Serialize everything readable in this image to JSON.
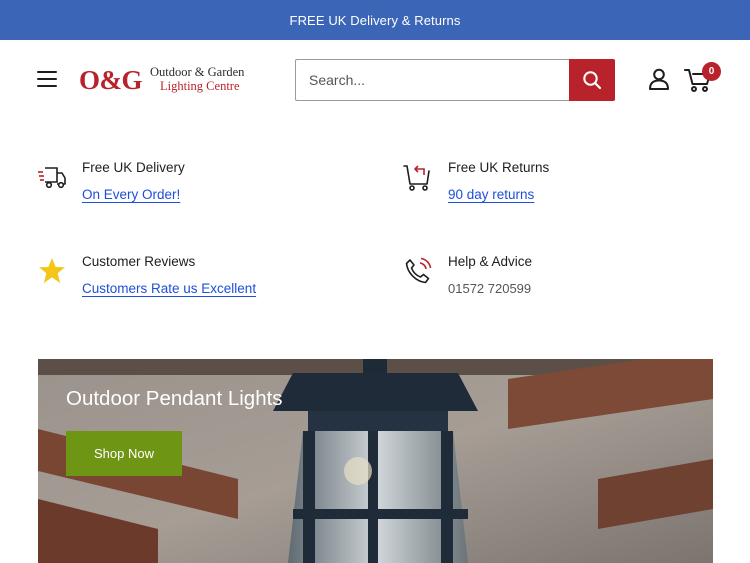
{
  "announcement": {
    "text": "FREE UK Delivery & Returns"
  },
  "header": {
    "logo": {
      "mark": "O&G",
      "line1": "Outdoor & Garden",
      "line2": "Lighting Centre"
    },
    "search": {
      "placeholder": "Search..."
    },
    "cart": {
      "count": "0"
    }
  },
  "features": [
    {
      "icon": "delivery-truck-icon",
      "title": "Free UK Delivery",
      "detail": "On Every Order!"
    },
    {
      "icon": "cart-return-icon",
      "title": "Free UK Returns",
      "detail": "90 day returns"
    },
    {
      "icon": "star-icon",
      "title": "Customer Reviews",
      "detail": "Customers Rate us Excellent"
    },
    {
      "icon": "phone-icon",
      "title": "Help & Advice",
      "detail": "01572 720599"
    }
  ],
  "hero": {
    "title": "Outdoor Pendant Lights",
    "button": "Shop Now"
  },
  "colors": {
    "announcement_bg": "#3b66b7",
    "brand_red": "#b8222b",
    "link_blue": "#1d4fd8",
    "button_green": "#6f9514",
    "star_yellow": "#f5c518"
  }
}
